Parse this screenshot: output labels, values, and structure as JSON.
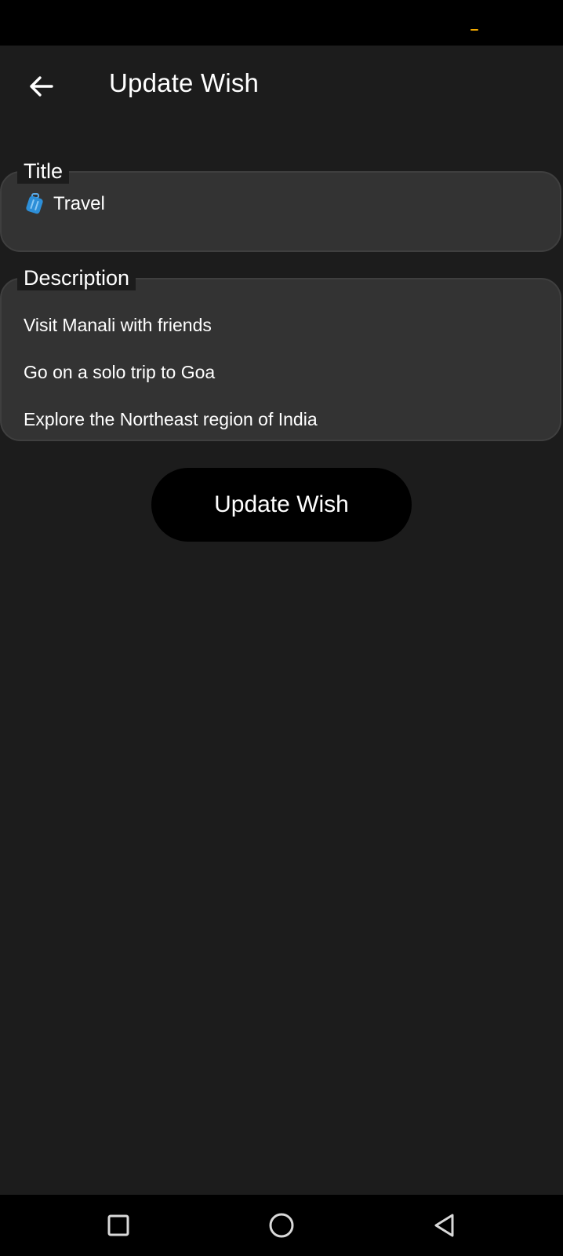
{
  "header": {
    "title": "Update Wish",
    "back_icon": "arrow-left-icon"
  },
  "form": {
    "title_field": {
      "label": "Title",
      "icon": "luggage-emoji-icon",
      "value": "Travel"
    },
    "description_field": {
      "label": "Description",
      "lines": [
        "Visit Manali with friends",
        "Go on a solo trip to Goa",
        "Explore the Northeast region of India"
      ]
    },
    "submit_label": "Update Wish"
  },
  "navigation": {
    "buttons": [
      "recents-square-icon",
      "home-circle-icon",
      "back-triangle-icon"
    ]
  },
  "colors": {
    "background": "#1c1c1c",
    "field_fill": "#333333",
    "button_fill": "#000000",
    "status_accent": "#f2a900"
  }
}
